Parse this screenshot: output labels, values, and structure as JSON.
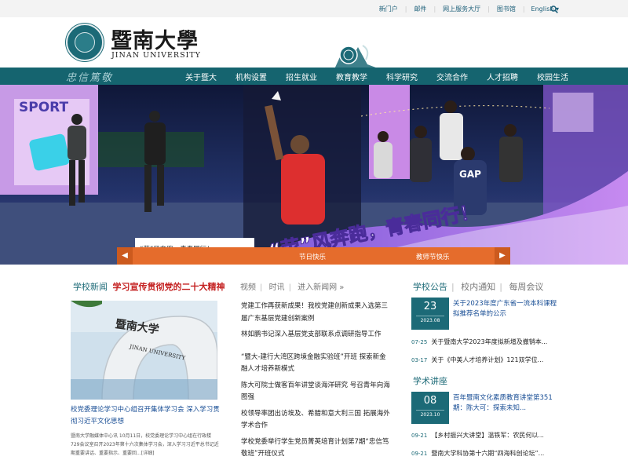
{
  "topbar": {
    "links": [
      "新门户",
      "邮件",
      "网上服务大厅",
      "图书馆"
    ],
    "language": "English"
  },
  "header": {
    "name_cn": "暨南大學",
    "name_en": "JINAN UNIVERSITY"
  },
  "nav": {
    "motto": "忠信篤敬",
    "items": [
      "关于暨大",
      "机构设置",
      "招生就业",
      "教育教学",
      "科学研究",
      "交流合作",
      "人才招聘",
      "校园生活"
    ]
  },
  "banner": {
    "caption": "“荧”风奔跑，青春同行！",
    "overlay_text": "“荧”风奔跑，青春同行！",
    "sign_text": "SPORT",
    "tabs": [
      "节日快乐",
      "教师节快乐"
    ]
  },
  "news": {
    "section_title": "学校新闻",
    "highlight": "学习宣传贯彻党的二十大精神",
    "image_text": "暨南大学",
    "image_text_en": "JINAN UNIVERSITY",
    "headline": "校党委理论学习中心组召开集体学习会 深入学习贯彻习近平文化思想",
    "summary": "暨南大学融媒体中心讯 10月11日，校党委理论学习中心组在行政楼729会议室召开2023年第十六次集体学习会，深入学习习近平总书记近期重要讲话、重要指示、重要回...[详细]"
  },
  "media": {
    "tabs": [
      "视频",
      "时讯",
      "进入新闻网 »"
    ],
    "items": [
      "党建工作再获新成果！我校党建创新成果入选第三届广东基层党建创新案例",
      "林如鹏书记深入基层党支部联系点调研指导工作",
      "“暨大-建行大湾区跨境金融实验班”开班 探索新金融人才培养新模式",
      "陈大可院士做客百年讲堂谈海洋研究 号召青年向海图强",
      "校领导率团出访埃及、希腊和意大利三国 拓展海外学术合作",
      "学校党委举行学生党员菁英培育计划第7期“忠信笃敬班”开班仪式"
    ]
  },
  "notices": {
    "tabs": [
      "学校公告",
      "校内通知",
      "每周会议"
    ],
    "featured": {
      "day": "23",
      "ym": "2023.08",
      "title": "关于2023年度广东省一流本科课程拟推荐名单的公示"
    },
    "items": [
      {
        "date": "07-25",
        "text": "关于暨南大学2023年度拟新增及撤销本..."
      },
      {
        "date": "03-17",
        "text": "关于《中美人才培养计划》121双学位..."
      }
    ]
  },
  "lectures": {
    "title": "学术讲座",
    "featured": {
      "day": "08",
      "ym": "2023.10",
      "title": "百年暨南文化素质教育讲堂第351期：陈大可：探索未知..."
    },
    "items": [
      {
        "date": "09-21",
        "text": "【乡村振兴大讲堂】温铁军：农民何以..."
      },
      {
        "date": "09-21",
        "text": "暨南大学科协第十六期“四海科创论坛”..."
      }
    ]
  },
  "colors": {
    "brand_teal": "#15646f",
    "accent_orange": "#e56c2c",
    "highlight_red": "#c42020",
    "link_blue": "#1a4f96"
  }
}
